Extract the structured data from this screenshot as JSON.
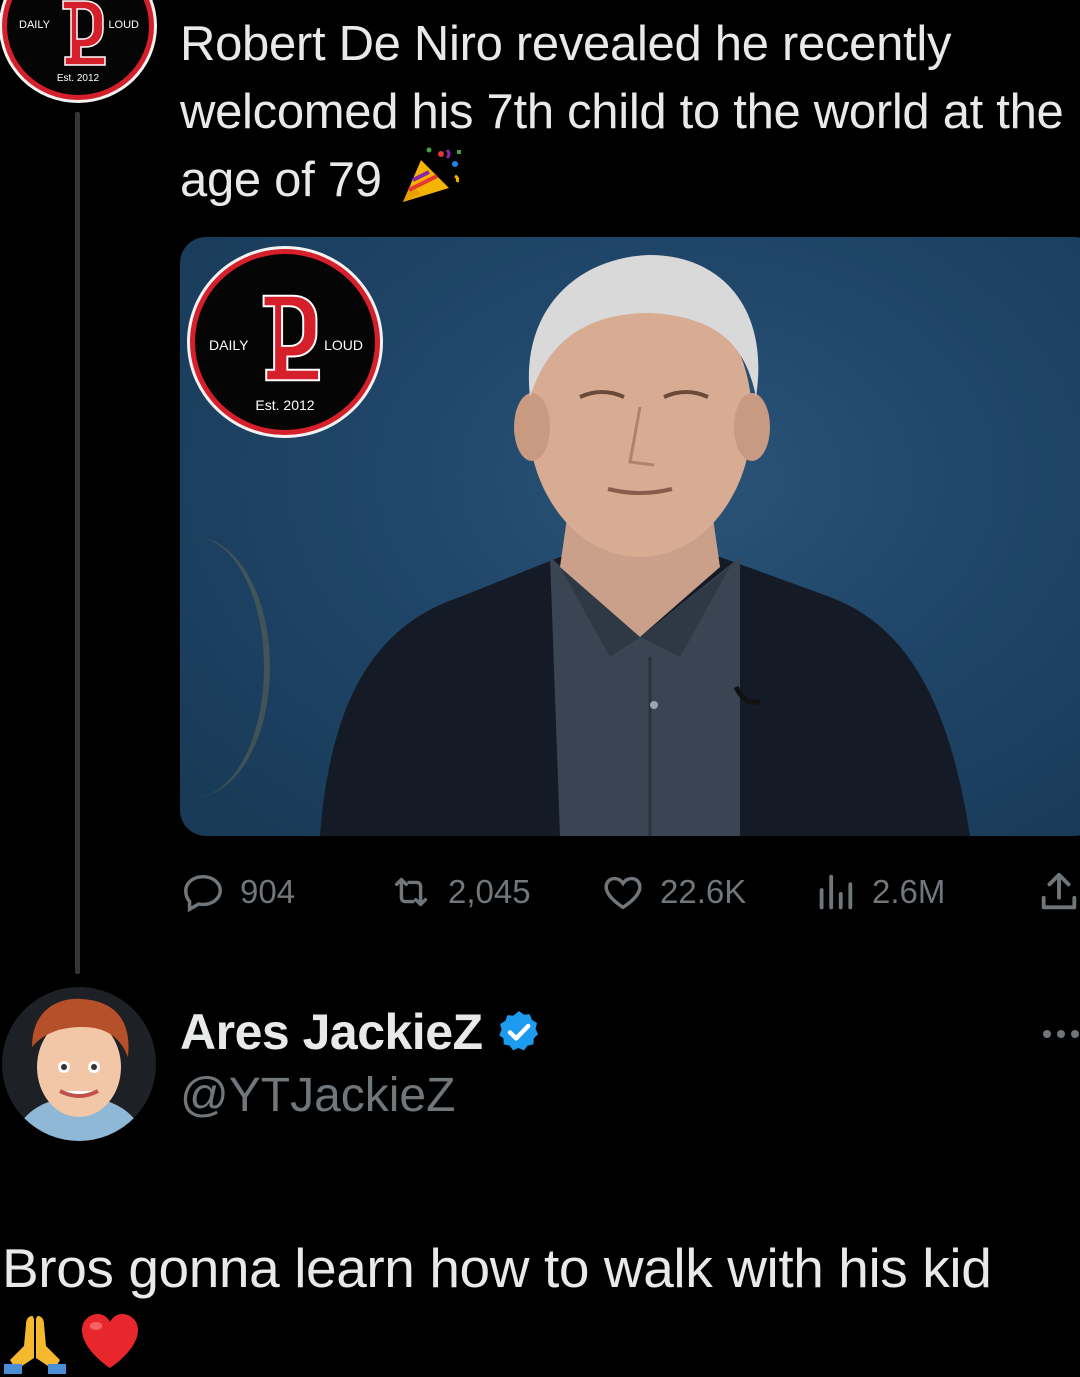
{
  "logo": {
    "left_word": "DAILY",
    "right_word": "LOUD",
    "est": "Est. 2012",
    "brand_color": "#d5202c"
  },
  "tweet": {
    "text": "Robert De Niro revealed he recently welcomed his 7th child to the world at the age of 79",
    "emoji_icon": "party-popper-icon",
    "stats": {
      "replies": "904",
      "retweets": "2,045",
      "likes": "22.6K",
      "views": "2.6M"
    }
  },
  "reply": {
    "name": "Ares JackieZ",
    "handle": "@YTJackieZ",
    "verified": true,
    "text": "Bros gonna learn how to walk with his kid",
    "emoji_icons": [
      "folded-hands-icon",
      "red-heart-icon"
    ]
  },
  "colors": {
    "background": "#000000",
    "text": "#e7e9ea",
    "muted": "#71767b",
    "verified_blue": "#1d9bf0",
    "thread_line": "#333639"
  }
}
